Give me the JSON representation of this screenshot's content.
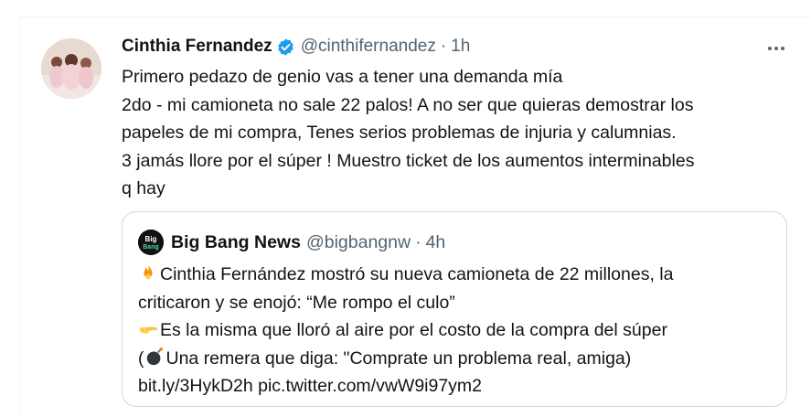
{
  "tweet": {
    "author_name": "Cinthia Fernandez",
    "author_handle": "@cinthifernandez",
    "separator": "·",
    "time": "1h",
    "lines": [
      "Primero pedazo de genio vas a tener una demanda mía",
      "2do - mi camioneta no sale 22 palos! A no ser que quieras demostrar los",
      "papeles de mi compra, Tenes serios problemas de injuria y calumnias.",
      "3 jamás llore por el súper ! Muestro ticket de los aumentos interminables",
      "q hay"
    ],
    "icons": {
      "verified": "verified-badge-icon",
      "more": "more-options-icon"
    },
    "colors": {
      "verified": "#1d9bf0",
      "secondary_text": "#536471",
      "border": "#cfd9de"
    }
  },
  "quote": {
    "author_name": "Big Bang News",
    "author_handle": "@bigbangnw",
    "separator": "·",
    "time": "4h",
    "lines": [
      "Cinthia Fernández mostró su nueva camioneta de 22 millones, la",
      "criticaron y se enojó: “Me rompo el culo”",
      "Es la misma que lloró al aire por el costo de la compra del súper",
      "(",
      "Una remera que diga: \"Comprate un problema real, amiga)",
      "bit.ly/3HykD2h pic.twitter.com/vwW9i97ym2"
    ],
    "icons": {
      "fire": "fire-emoji-icon",
      "pointing": "pointing-hand-emoji-icon",
      "bomb": "bomb-emoji-icon"
    }
  }
}
